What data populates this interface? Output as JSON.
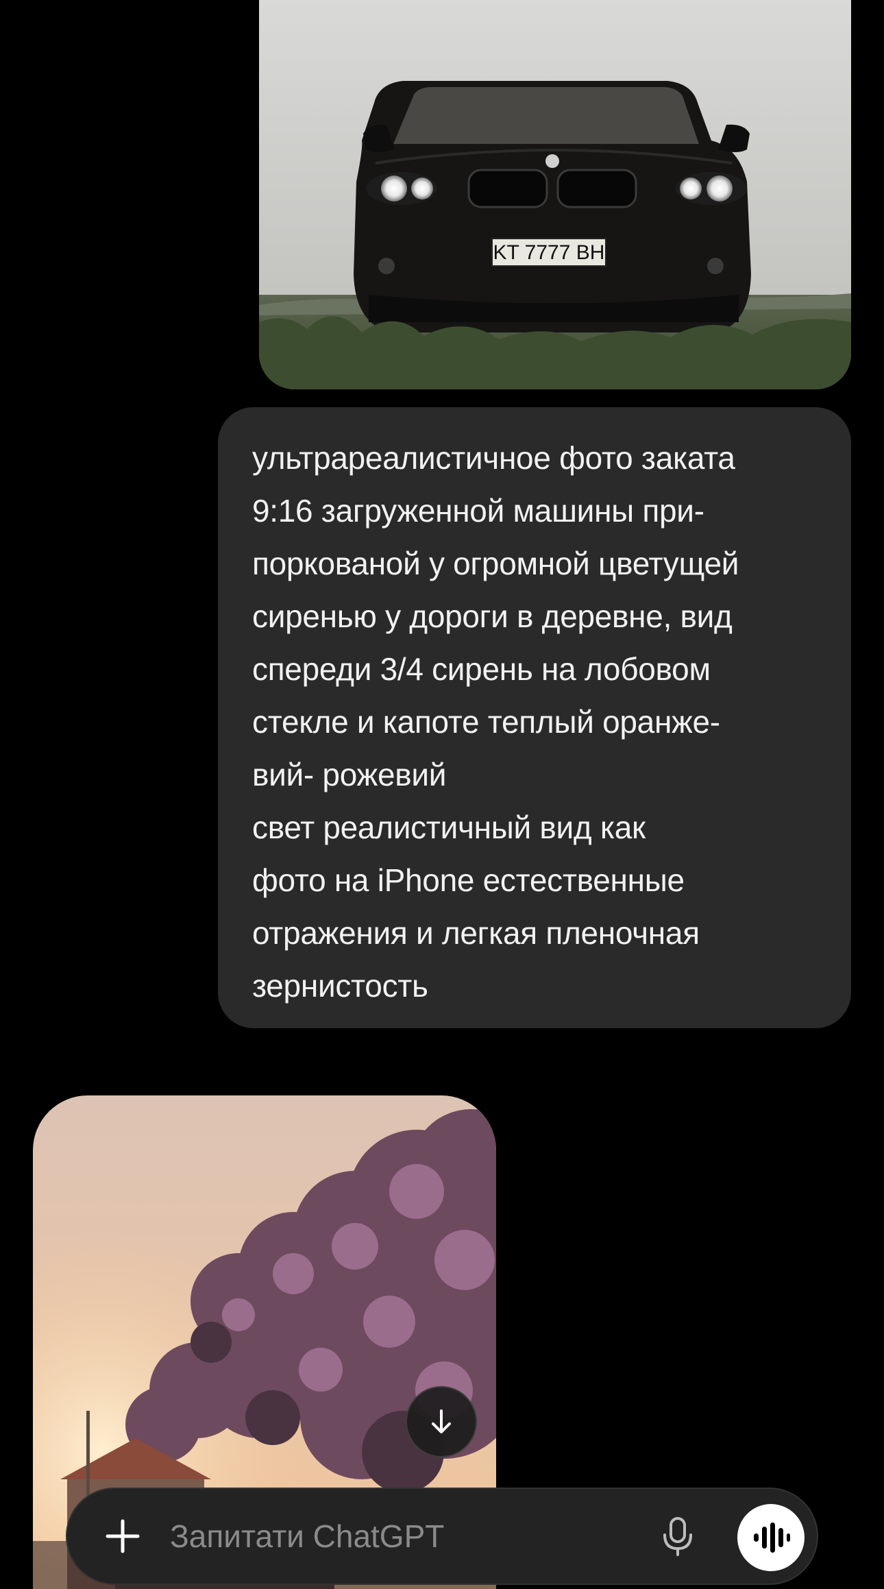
{
  "colors": {
    "background": "#000000",
    "user_bubble": "#2a2a2a",
    "composer_bg": "#232323",
    "placeholder": "#8b8b8b",
    "text": "#f2f2f2"
  },
  "messages": {
    "user_image": {
      "alt": "",
      "plate": "KT 7777 BH"
    },
    "user_prompt": {
      "lines": [
        "ультрареалистичное фото заката",
        "9:16 загруженной машины при-",
        "поркованой у огромной цветущей",
        "сиренью у дороги в деревне, вид",
        "спереди 3/4 сирень на лобовом",
        "стекле и капоте теплый оранже-",
        "вий- рожевий",
        "свет реалистичный вид как",
        "фото на iPhone естественные",
        "отражения и легкая пленочная",
        "зернистость"
      ]
    },
    "assistant_image": {
      "alt": ""
    }
  },
  "scroll_down": {
    "icon": "arrow-down-icon"
  },
  "composer": {
    "plus_icon": "plus-icon",
    "placeholder": "Запитати ChatGPT",
    "mic_icon": "microphone-icon",
    "voice_icon": "voice-waveform-icon"
  }
}
